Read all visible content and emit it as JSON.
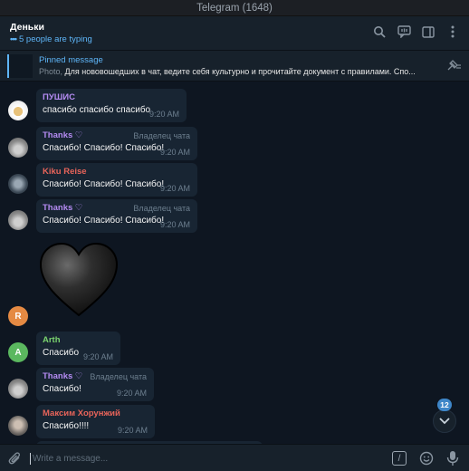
{
  "window": {
    "title": "Telegram (1648)"
  },
  "header": {
    "chat_name": "Деньки",
    "typing_status": "5 people are typing",
    "icons": [
      "search-icon",
      "chat-icon",
      "sidebar-toggle-icon",
      "more-icon"
    ]
  },
  "pinned": {
    "label": "Pinned message",
    "media_type": "Photo,",
    "text": "Для нововошедших в чат, ведите себя культурно и прочитайте документ с правилами. Спо..."
  },
  "messages": [
    {
      "author": "ПУШИС",
      "author_color": "#b48bf2",
      "text": "спасибо спасибо спасибо",
      "time": "9:20 AM",
      "badge": ""
    },
    {
      "author": "Thanks ♡",
      "author_color": "#b48bf2",
      "text": "Спасибо! Спасибо! Спасибо!",
      "time": "9:20 AM",
      "badge": "Владелец чата"
    },
    {
      "author": "Kiku Reise",
      "author_color": "#e8645a",
      "text": "Спасибо! Спасибо! Спасибо!",
      "time": "9:20 AM",
      "badge": ""
    },
    {
      "author": "Thanks ♡",
      "author_color": "#b48bf2",
      "text": "Спасибо! Спасибо! Спасибо!",
      "time": "9:20 AM",
      "badge": "Владелец чата"
    },
    {
      "author": "",
      "author_color": "",
      "text": "",
      "time": "",
      "badge": "",
      "avatar_letter": "R"
    },
    {
      "author": "Arth",
      "author_color": "#7ad36e",
      "text": "Спасибо",
      "time": "9:20 AM",
      "badge": "",
      "avatar_letter": "A"
    },
    {
      "author": "Thanks ♡",
      "author_color": "#b48bf2",
      "text": "Спасибо!",
      "time": "9:20 AM",
      "badge": "Владелец чата"
    },
    {
      "author": "Максим Хорунжий",
      "author_color": "#e8645a",
      "text": "Спасибо!!!!",
      "time": "9:20 AM",
      "badge": ""
    }
  ],
  "scroll": {
    "unread_count": "12"
  },
  "composer": {
    "placeholder": "Write a message..."
  },
  "colors": {
    "background": "#0e1621",
    "panel": "#17212b",
    "bubble": "#182533",
    "accent": "#5eb5f7"
  }
}
